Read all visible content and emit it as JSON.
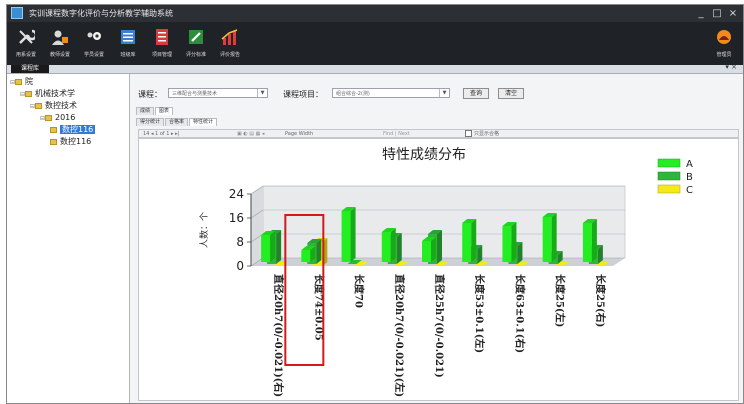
{
  "window": {
    "title": "实训课程数字化评价与分析教学辅助系统",
    "controls": [
      "_",
      "□",
      "×"
    ]
  },
  "toolbar": {
    "buttons": [
      {
        "label": "用系设置",
        "icon": "wrench-icon"
      },
      {
        "label": "教师设置",
        "icon": "teacher-icon"
      },
      {
        "label": "学员设置",
        "icon": "students-icon"
      },
      {
        "label": "班级库",
        "icon": "class-list-icon"
      },
      {
        "label": "项目管理",
        "icon": "project-icon"
      },
      {
        "label": "评分标准",
        "icon": "grading-icon"
      },
      {
        "label": "评价报告",
        "icon": "report-icon"
      }
    ],
    "right_label": "管理员"
  },
  "subbar": {
    "tab_label": "课程库",
    "pin": "▾ ×"
  },
  "tree": {
    "nodes": [
      {
        "label": "院",
        "level": 0,
        "expander": "⊟"
      },
      {
        "label": "机械技术学",
        "level": 1,
        "expander": "⊟"
      },
      {
        "label": "数控技术",
        "level": 2,
        "expander": "⊟"
      },
      {
        "label": "2016",
        "level": 3,
        "expander": "⊟"
      },
      {
        "label": "数控116",
        "level": 4,
        "expander": "",
        "selected": true
      },
      {
        "label": "数控116",
        "level": 4,
        "expander": ""
      }
    ]
  },
  "filters": {
    "course_label": "课程：",
    "course_value": "三维配合与测量技术",
    "project_label": "课程项目：",
    "project_value": "组合综合-2(测)",
    "query_button": "查询",
    "clear_button": "清空"
  },
  "tabs_top": [
    {
      "label": "成绩",
      "active": false
    },
    {
      "label": "图表",
      "active": true
    }
  ],
  "tabs_sub": [
    {
      "label": "得分统计",
      "active": false
    },
    {
      "label": "合格率",
      "active": false
    },
    {
      "label": "特性统计",
      "active": true
    }
  ],
  "report_toolbar": {
    "page_info": "14  ◂ 1  of 1 ▸ ▸|",
    "zoom": "Page Width",
    "find": "Find | Next",
    "checkbox_label": "只显示合格"
  },
  "chart_data": {
    "type": "bar",
    "title": "特性成绩分布",
    "ylabel": "人数：个",
    "ylim": [
      0,
      24
    ],
    "yticks": [
      0,
      8,
      16,
      24
    ],
    "categories": [
      "直径20h7(0/-0.021)(右)",
      "长度74±0.05",
      "长度70",
      "直径20h7(0/-0.021)(左)",
      "直径25h7(0/-0.021)",
      "长度53±0.1(左)",
      "长度63±0.1(右)",
      "长度25(左)",
      "长度25(右)"
    ],
    "series": [
      {
        "name": "A",
        "color": "#22ee22",
        "values": [
          9,
          4,
          17,
          10,
          7,
          13,
          12,
          15,
          13
        ]
      },
      {
        "name": "B",
        "color": "#2fb53a",
        "values": [
          10,
          7,
          0,
          9,
          10,
          5,
          6,
          3,
          5
        ]
      },
      {
        "name": "C",
        "color": "#f4ea1a",
        "values": [
          0,
          8,
          0,
          0,
          0,
          0,
          0,
          0,
          0
        ]
      }
    ],
    "highlight_category": "长度74±0.05",
    "legend_position": "top-right",
    "grid": true
  }
}
